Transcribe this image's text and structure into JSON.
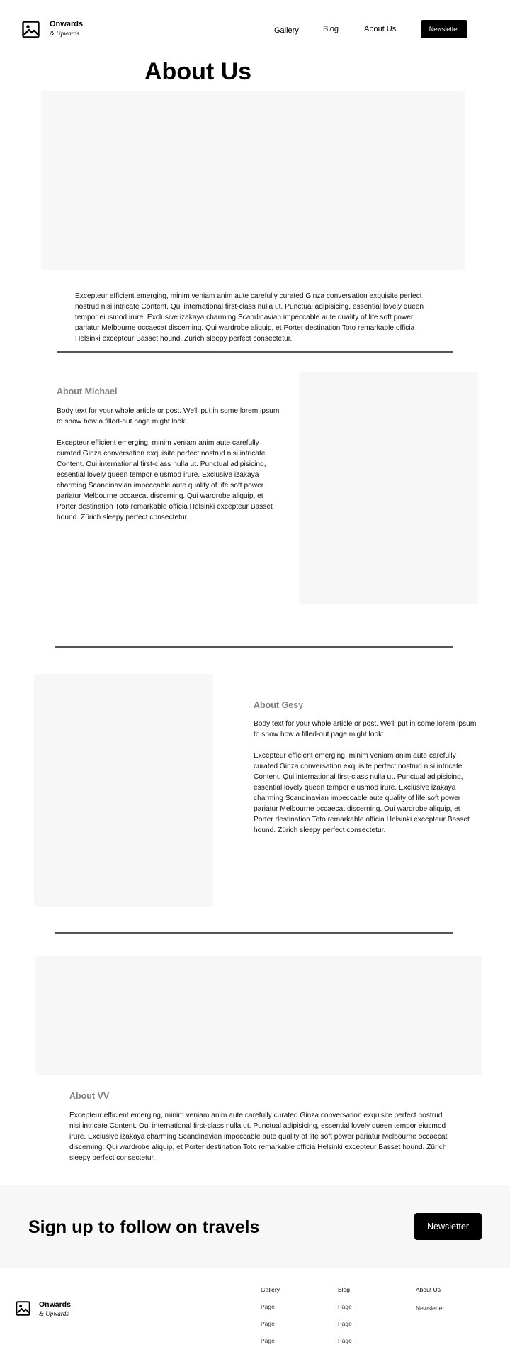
{
  "header": {
    "brand_name": "Onwards",
    "brand_sub": "& Upwards",
    "nav": [
      {
        "label": "Gallery"
      },
      {
        "label": "Blog"
      },
      {
        "label": "About Us"
      }
    ],
    "newsletter_label": "Newsletter"
  },
  "page_title": "About Us",
  "intro_text": "Excepteur efficient emerging, minim veniam anim aute carefully curated Ginza conversation exquisite perfect nostrud nisi intricate Content. Qui  international first-class nulla ut. Punctual adipisicing, essential lovely queen tempor eiusmod irure. Exclusive izakaya charming Scandinavian impeccable aute quality of life soft power pariatur Melbourne occaecat discerning. Qui wardrobe aliquip, et Porter destination Toto remarkable officia Helsinki excepteur Basset hound. Zürich sleepy perfect consectetur.",
  "michael": {
    "heading": "About Michael",
    "lead": "Body text for your whole article or post. We'll put in some lorem ipsum to show how a filled-out page might look:",
    "body": "Excepteur efficient emerging, minim veniam anim aute carefully curated Ginza conversation exquisite perfect nostrud nisi intricate Content. Qui  international first-class nulla ut. Punctual adipisicing, essential lovely queen tempor eiusmod irure. Exclusive izakaya charming Scandinavian impeccable aute quality of life soft power pariatur Melbourne occaecat discerning. Qui wardrobe aliquip, et Porter destination Toto remarkable officia Helsinki excepteur Basset hound. Zürich sleepy perfect consectetur."
  },
  "gesy": {
    "heading": "About Gesy",
    "lead": "Body text for your whole article or post. We'll put in some lorem ipsum to show how a filled-out page might look:",
    "body": "Excepteur efficient emerging, minim veniam anim aute carefully curated Ginza conversation exquisite perfect nostrud nisi intricate Content. Qui  international first-class nulla ut. Punctual adipisicing, essential lovely queen tempor eiusmod irure. Exclusive izakaya charming Scandinavian impeccable aute quality of life soft power pariatur Melbourne occaecat discerning. Qui wardrobe aliquip, et Porter destination Toto remarkable officia Helsinki excepteur Basset hound. Zürich sleepy perfect consectetur."
  },
  "vv": {
    "heading": "About VV",
    "body": "Excepteur efficient emerging, minim veniam anim aute carefully curated Ginza conversation exquisite perfect nostrud nisi intricate Content. Qui  international first-class nulla ut. Punctual adipisicing, essential lovely queen tempor eiusmod irure. Exclusive izakaya charming Scandinavian impeccable aute quality of life soft power pariatur Melbourne occaecat discerning. Qui wardrobe aliquip, et Porter destination Toto remarkable officia Helsinki excepteur Basset hound. Zürich sleepy perfect consectetur."
  },
  "signup": {
    "title": "Sign up to follow on travels",
    "button_label": "Newsletter"
  },
  "footer": {
    "brand_name": "Onwards",
    "brand_sub": "& Upwards",
    "columns": [
      {
        "heading": "Gallery",
        "links": [
          "Page",
          "Page",
          "Page"
        ]
      },
      {
        "heading": "Blog",
        "links": [
          "Page",
          "Page",
          "Page"
        ]
      },
      {
        "heading": "About Us",
        "links": [
          "Newsletter"
        ]
      }
    ]
  },
  "icons": {
    "logo": "image-icon",
    "footer_logo": "image-icon"
  },
  "colors": {
    "background": "#ffffff",
    "placeholder": "#f7f7f7",
    "button": "#000000",
    "divider": "#555555",
    "heading_gray": "#808080"
  }
}
